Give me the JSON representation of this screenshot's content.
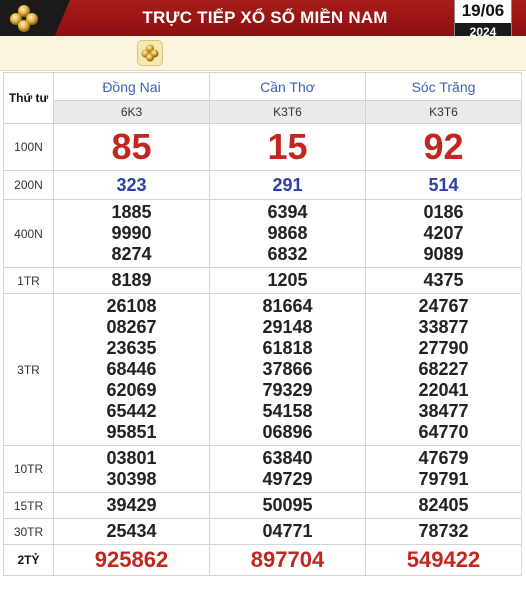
{
  "header": {
    "title": "TRỰC TIẾP XỔ SỐ MIỀN NAM",
    "date": "19/06",
    "year": "2024",
    "colors": {
      "header_red": "#a81d1b",
      "dark": "#1a1a1a",
      "prize_red": "#c1271f",
      "blue": "#2c3ea8"
    },
    "logo_icon": "clover-logo-icon"
  },
  "subbar": {
    "icon": "clover-icon"
  },
  "table": {
    "day": "Thứ tư",
    "provinces": [
      "Đồng Nai",
      "Cần Thơ",
      "Sóc Trăng"
    ],
    "codes": [
      "6K3",
      "K3T6",
      "K3T6"
    ],
    "prizes": [
      {
        "label": "100N",
        "values": [
          [
            "85"
          ],
          [
            "15"
          ],
          [
            "92"
          ]
        ]
      },
      {
        "label": "200N",
        "values": [
          [
            "323"
          ],
          [
            "291"
          ],
          [
            "514"
          ]
        ]
      },
      {
        "label": "400N",
        "values": [
          [
            "1885",
            "9990",
            "8274"
          ],
          [
            "6394",
            "9868",
            "6832"
          ],
          [
            "0186",
            "4207",
            "9089"
          ]
        ]
      },
      {
        "label": "1TR",
        "values": [
          [
            "8189"
          ],
          [
            "1205"
          ],
          [
            "4375"
          ]
        ]
      },
      {
        "label": "3TR",
        "values": [
          [
            "26108",
            "08267",
            "23635",
            "68446",
            "62069",
            "65442",
            "95851"
          ],
          [
            "81664",
            "29148",
            "61818",
            "37866",
            "79329",
            "54158",
            "06896"
          ],
          [
            "24767",
            "33877",
            "27790",
            "68227",
            "22041",
            "38477",
            "64770"
          ]
        ]
      },
      {
        "label": "10TR",
        "values": [
          [
            "03801",
            "30398"
          ],
          [
            "63840",
            "49729"
          ],
          [
            "47679",
            "79791"
          ]
        ]
      },
      {
        "label": "15TR",
        "values": [
          [
            "39429"
          ],
          [
            "50095"
          ],
          [
            "82405"
          ]
        ]
      },
      {
        "label": "30TR",
        "values": [
          [
            "25434"
          ],
          [
            "04771"
          ],
          [
            "78732"
          ]
        ]
      },
      {
        "label": "2TỶ",
        "values": [
          [
            "925862"
          ],
          [
            "897704"
          ],
          [
            "549422"
          ]
        ]
      }
    ]
  }
}
